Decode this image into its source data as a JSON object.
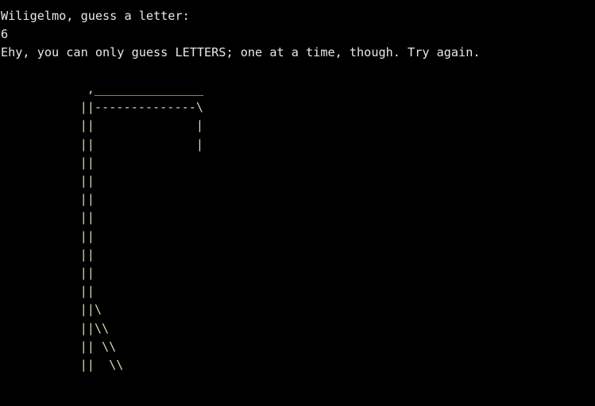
{
  "terminal": {
    "background": "#000000",
    "text_color": "#e8e8e8",
    "art_color": "#dcd8b0",
    "prompt": "Wiligelmo, guess a letter:",
    "user_input": "6",
    "error_message": "Ehy, you can only guess LETTERS; one at a time, though. Try again."
  },
  "gallows_lines": [
    "            ,_______________",
    "           ||--------------\\",
    "           ||              |",
    "           ||              |",
    "           ||",
    "           ||",
    "           ||",
    "           ||",
    "           ||",
    "           ||",
    "           ||",
    "           ||",
    "           ||\\",
    "           ||\\\\",
    "           || \\\\",
    "           ||  \\\\"
  ]
}
